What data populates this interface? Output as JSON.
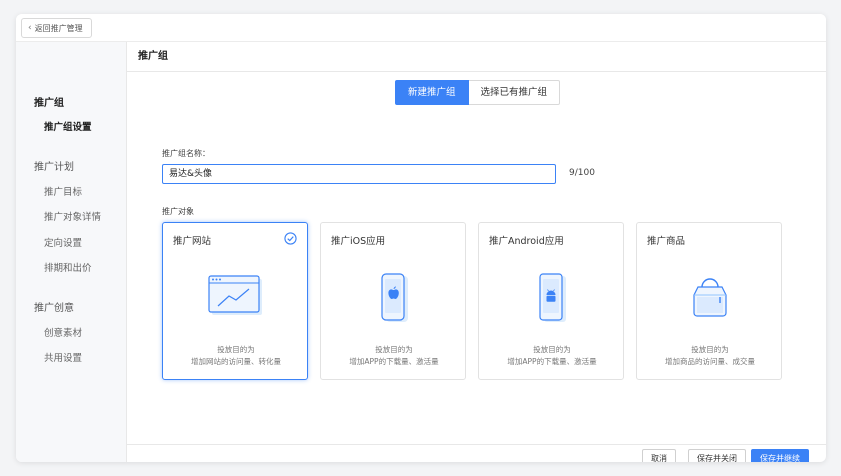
{
  "topbar": {
    "back_label": "返回推广管理"
  },
  "sidebar": {
    "group1": {
      "title": "推广组",
      "items": [
        "推广组设置"
      ]
    },
    "group2": {
      "title": "推广计划",
      "items": [
        "推广目标",
        "推广对象详情",
        "定向设置",
        "排期和出价"
      ]
    },
    "group3": {
      "title": "推广创意",
      "items": [
        "创意素材",
        "共用设置"
      ]
    }
  },
  "main": {
    "title": "推广组",
    "tabs": {
      "new": "新建推广组",
      "existing": "选择已有推广组"
    },
    "name_label": "推广组名称：",
    "name_value": "易达&头像",
    "name_counter": "9/100",
    "target_label": "推广对象",
    "cards": [
      {
        "title": "推广网站",
        "desc1": "投放目的为",
        "desc2": "增加网站的访问量、转化量"
      },
      {
        "title": "推广iOS应用",
        "desc1": "投放目的为",
        "desc2": "增加APP的下载量、激活量"
      },
      {
        "title": "推广Android应用",
        "desc1": "投放目的为",
        "desc2": "增加APP的下载量、激活量"
      },
      {
        "title": "推广商品",
        "desc1": "投放目的为",
        "desc2": "增加商品的访问量、成交量"
      }
    ]
  },
  "footer": {
    "cancel": "取消",
    "save_close": "保存并关闭",
    "save_continue": "保存并继续"
  },
  "colors": {
    "accent": "#3b82f6"
  }
}
